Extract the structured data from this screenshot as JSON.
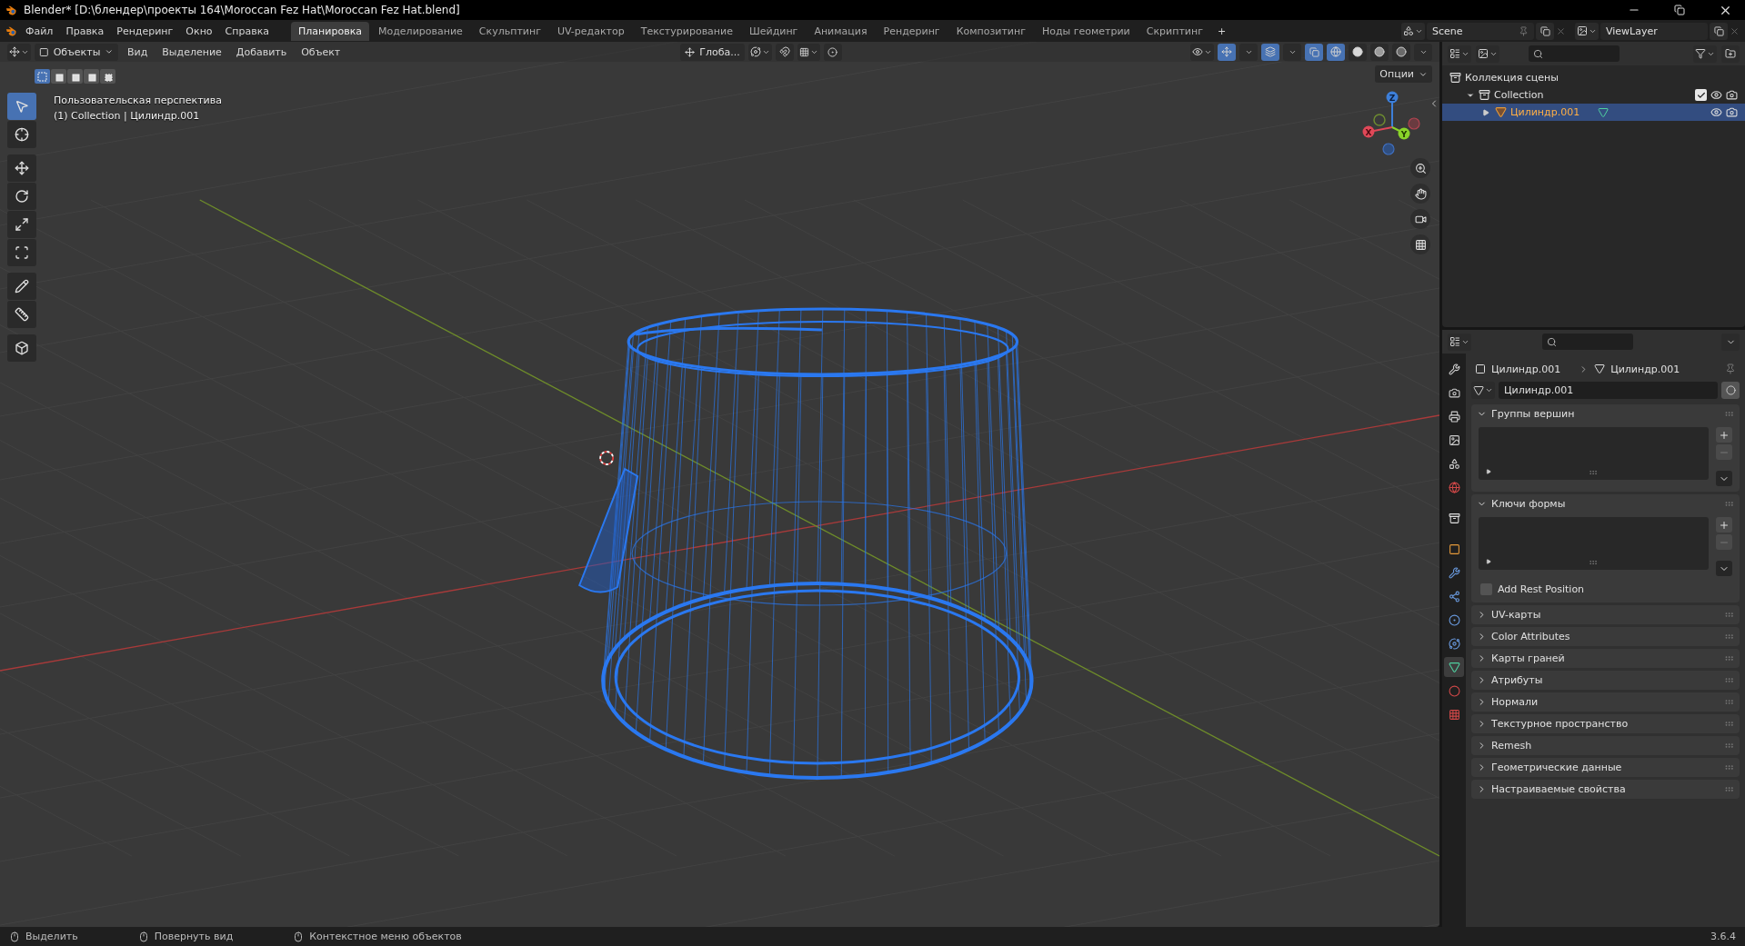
{
  "window": {
    "title": "Blender* [D:\\блендер\\проекты 164\\Moroccan Fez Hat\\Moroccan Fez Hat.blend]"
  },
  "menu": [
    "Файл",
    "Правка",
    "Рендеринг",
    "Окно",
    "Справка"
  ],
  "workspaces": [
    {
      "label": "Планировка",
      "selected": true
    },
    {
      "label": "Моделирование",
      "selected": false
    },
    {
      "label": "Скульптинг",
      "selected": false
    },
    {
      "label": "UV-редактор",
      "selected": false
    },
    {
      "label": "Текстурирование",
      "selected": false
    },
    {
      "label": "Шейдинг",
      "selected": false
    },
    {
      "label": "Анимация",
      "selected": false
    },
    {
      "label": "Рендеринг",
      "selected": false
    },
    {
      "label": "Композитинг",
      "selected": false
    },
    {
      "label": "Ноды геометрии",
      "selected": false
    },
    {
      "label": "Скриптинг",
      "selected": false
    }
  ],
  "add_workspace": "+",
  "scene": "Scene",
  "view_layer": "ViewLayer",
  "viewport": {
    "mode": "Объекты",
    "menus": [
      "Вид",
      "Выделение",
      "Добавить",
      "Объект"
    ],
    "orientation": "Глоба...",
    "options": "Опции",
    "view_name": "Пользовательская перспектива",
    "context": "(1) Collection | Цилиндр.001",
    "select_modes": [
      {
        "selected": true
      },
      {
        "selected": false
      },
      {
        "selected": false
      },
      {
        "selected": false
      },
      {
        "selected": false
      }
    ],
    "tools": [
      {
        "kind": "select",
        "selected": true
      },
      {
        "kind": "cursor",
        "selected": false
      },
      {
        "kind": "move",
        "selected": false
      },
      {
        "kind": "rotate",
        "selected": false
      },
      {
        "kind": "scale",
        "selected": false
      },
      {
        "kind": "transform",
        "selected": false
      },
      {
        "kind": "annotate",
        "selected": false
      },
      {
        "kind": "measure",
        "selected": false
      },
      {
        "kind": "add_cube",
        "selected": false
      }
    ],
    "shading": [
      {
        "kind": "wireframe",
        "selected": true
      },
      {
        "kind": "solid",
        "selected": false
      },
      {
        "kind": "material",
        "selected": false
      },
      {
        "kind": "rendered",
        "selected": false
      }
    ],
    "gizmo": {
      "x": "X",
      "y": "Y",
      "z": "Z"
    }
  },
  "outliner": {
    "items": [
      {
        "kind": "scene_collection",
        "label": "Коллекция сцены",
        "selected": false,
        "children": [
          {
            "kind": "collection",
            "label": "Collection",
            "selected": false,
            "expanded": true,
            "checked": true,
            "children": [
              {
                "kind": "mesh_object",
                "label": "Цилиндр.001",
                "selected": true,
                "expanded": false
              }
            ]
          }
        ]
      }
    ]
  },
  "properties": {
    "breadcrumb": [
      "Цилиндр.001",
      "Цилиндр.001"
    ],
    "mesh_name": "Цилиндр.001",
    "tabs": [
      {
        "kind": "tool",
        "selected": false
      },
      {
        "kind": "render",
        "selected": false
      },
      {
        "kind": "output",
        "selected": false
      },
      {
        "kind": "view_layer",
        "selected": false
      },
      {
        "kind": "scene",
        "selected": false
      },
      {
        "kind": "world",
        "selected": false
      },
      {
        "kind": "collection",
        "selected": false
      },
      {
        "kind": "object",
        "selected": false
      },
      {
        "kind": "modifiers",
        "selected": false
      },
      {
        "kind": "particles",
        "selected": false
      },
      {
        "kind": "physics",
        "selected": false
      },
      {
        "kind": "constraints",
        "selected": false
      },
      {
        "kind": "data",
        "selected": true
      },
      {
        "kind": "material",
        "selected": false
      },
      {
        "kind": "texture",
        "selected": false
      }
    ],
    "panels": [
      {
        "kind": "list",
        "title": "Группы вершин",
        "expanded": true
      },
      {
        "kind": "list",
        "title": "Ключи формы",
        "expanded": true,
        "checkbox": {
          "label": "Add Rest Position",
          "checked": false
        }
      },
      {
        "kind": "section",
        "title": "UV-карты",
        "expanded": false
      },
      {
        "kind": "section",
        "title": "Color Attributes",
        "expanded": false
      },
      {
        "kind": "section",
        "title": "Карты граней",
        "expanded": false
      },
      {
        "kind": "section",
        "title": "Атрибуты",
        "expanded": false
      },
      {
        "kind": "section",
        "title": "Нормали",
        "expanded": false
      },
      {
        "kind": "section",
        "title": "Текстурное пространство",
        "expanded": false
      },
      {
        "kind": "section",
        "title": "Remesh",
        "expanded": false
      },
      {
        "kind": "section",
        "title": "Геометрические данные",
        "expanded": false
      },
      {
        "kind": "section",
        "title": "Настраиваемые свойства",
        "expanded": false
      }
    ]
  },
  "status_bar": {
    "hints": [
      "Выделить",
      "Повернуть вид",
      "Контекстное меню объектов"
    ],
    "version": "3.6.4"
  }
}
